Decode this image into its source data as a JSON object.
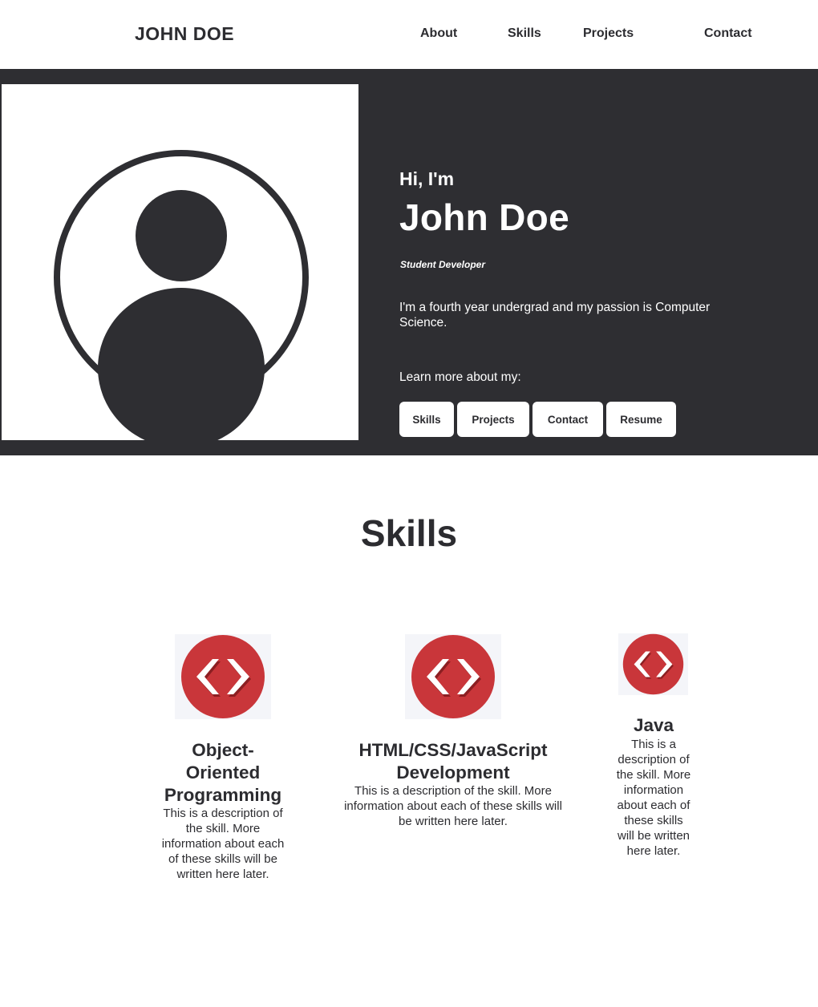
{
  "header": {
    "brand": "JOHN DOE",
    "nav": {
      "about": "About",
      "skills": "Skills",
      "projects": "Projects",
      "contact": "Contact"
    }
  },
  "hero": {
    "greeting": "Hi, I'm",
    "name": "John Doe",
    "role": "Student Developer",
    "bio": "I'm a fourth year undergrad and my passion is Computer Science.",
    "learn_more": "Learn more about my:",
    "buttons": {
      "skills": "Skills",
      "projects": "Projects",
      "contact": "Contact",
      "resume": "Resume"
    },
    "avatar_icon": "user-profile-icon"
  },
  "skills": {
    "title": "Skills",
    "items": [
      {
        "name": "Object-Oriented Programming",
        "description": "This is a description of the skill. More information about each of these skills will be written here later.",
        "icon": "code-icon"
      },
      {
        "name": "HTML/CSS/JavaScript Development",
        "description": "This is a description of the skill. More information about each of these skills will be written here later.",
        "icon": "code-icon"
      },
      {
        "name": "Java",
        "description": "This is a description of the skill. More information about each of these skills will be written here later.",
        "icon": "code-icon"
      }
    ]
  },
  "colors": {
    "dark": "#2e2e32",
    "text": "#2c2c30",
    "accent_red": "#c9363a",
    "white": "#ffffff"
  }
}
